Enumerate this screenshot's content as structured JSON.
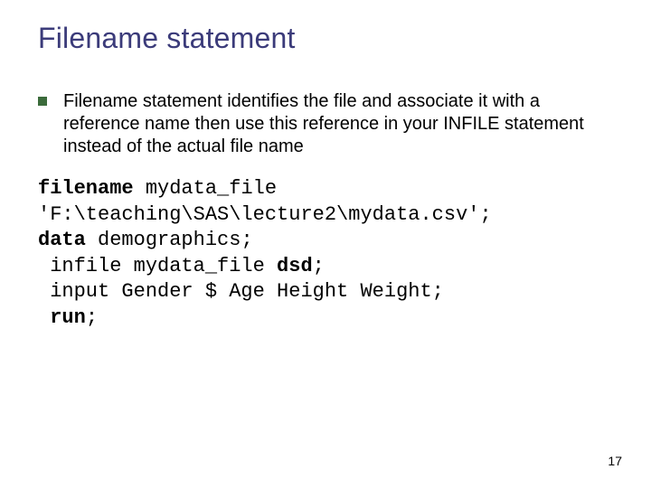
{
  "title": "Filename statement",
  "bullet": "Filename statement identifies the file and associate it with a reference name then use this reference in your INFILE statement instead of the actual file name",
  "code": {
    "kw_filename": "filename",
    "l1_rest": " mydata_file",
    "l2": "'F:\\teaching\\SAS\\lecture2\\mydata.csv';",
    "kw_data": "data",
    "l3_rest": " demographics;",
    "l4_pre": " infile mydata_file ",
    "kw_dsd": "dsd",
    "l4_post": ";",
    "l5": " input Gender $ Age Height Weight;",
    "kw_run": " run",
    "l6_post": ";"
  },
  "page_number": "17"
}
